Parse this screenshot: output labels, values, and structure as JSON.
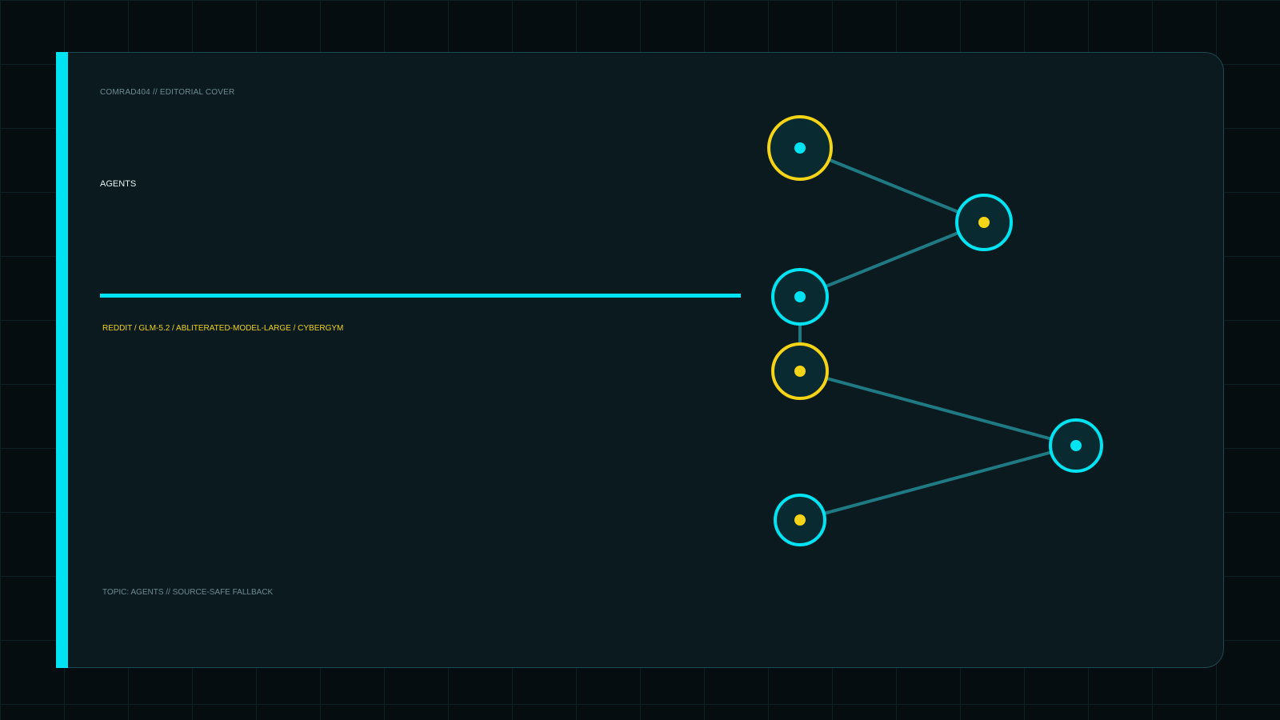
{
  "colors": {
    "cyan": "#00e3f2",
    "yellow": "#f5d316",
    "edge": "#1f7a84",
    "node_fill": "#082a30",
    "card": "#0b1a1e",
    "background": "#050d10"
  },
  "header": {
    "kicker": "COMRAD404 // EDITORIAL COVER",
    "title": "AGENTS"
  },
  "meta": {
    "tags": "REDDIT / GLM-5.2 / ABLITERATED-MODEL-LARGE / CYBERGYM"
  },
  "footer": {
    "text": "TOPIC: AGENTS // SOURCE-SAFE FALLBACK"
  },
  "graph": {
    "nodes": [
      {
        "id": "n1",
        "ring": "yellow",
        "dot": "cyan"
      },
      {
        "id": "n2",
        "ring": "cyan",
        "dot": "yellow"
      },
      {
        "id": "n3",
        "ring": "cyan",
        "dot": "cyan"
      },
      {
        "id": "n4",
        "ring": "yellow",
        "dot": "yellow"
      },
      {
        "id": "n5",
        "ring": "cyan",
        "dot": "cyan"
      },
      {
        "id": "n6",
        "ring": "cyan",
        "dot": "yellow"
      }
    ],
    "edges": [
      [
        "n1",
        "n2"
      ],
      [
        "n2",
        "n3"
      ],
      [
        "n3",
        "n4"
      ],
      [
        "n4",
        "n5"
      ],
      [
        "n5",
        "n6"
      ]
    ]
  }
}
